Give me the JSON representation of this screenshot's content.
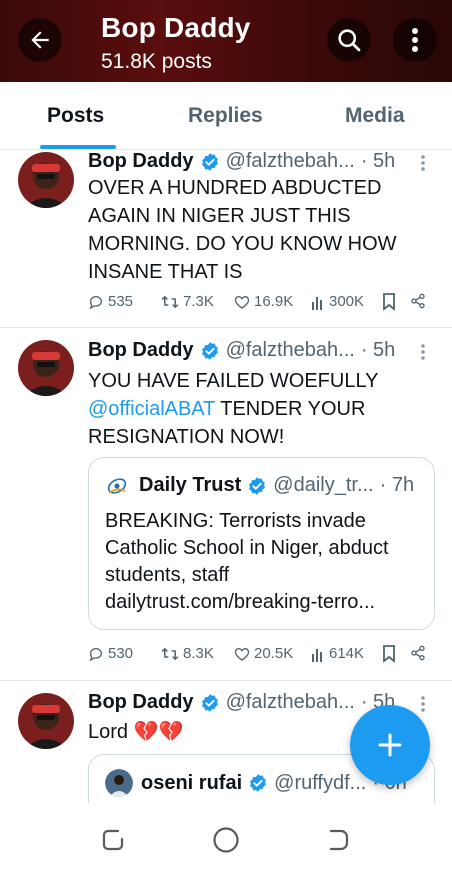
{
  "header": {
    "title": "Bop Daddy",
    "subtitle": "51.8K posts",
    "icons": [
      "back-arrow-icon",
      "search-icon",
      "more-vertical-icon"
    ]
  },
  "tabs": [
    {
      "label": "Posts",
      "active": true
    },
    {
      "label": "Replies",
      "active": false
    },
    {
      "label": "Media",
      "active": false
    }
  ],
  "posts": [
    {
      "name": "Bop Daddy",
      "handle": "@falzthebah...",
      "time": "· 5h",
      "text": "OVER A HUNDRED ABDUCTED AGAIN IN NIGER JUST THIS MORNING. DO YOU KNOW HOW INSANE THAT IS",
      "replies": "535",
      "reposts": "7.3K",
      "likes": "16.9K",
      "views": "300K"
    },
    {
      "name": "Bop Daddy",
      "handle": "@falzthebah...",
      "time": "· 5h",
      "text_before": "YOU HAVE FAILED WOEFULLY ",
      "mention": "@officialABAT",
      "text_after": " TENDER YOUR RESIGNATION NOW!",
      "quote": {
        "name": "Daily Trust",
        "handle": "@daily_tr...",
        "time": "· 7h",
        "text": "BREAKING: Terrorists invade Catholic School in Niger, abduct students, staff",
        "link": "dailytrust.com/breaking-terro..."
      },
      "replies": "530",
      "reposts": "8.3K",
      "likes": "20.5K",
      "views": "614K"
    },
    {
      "name": "Bop Daddy",
      "handle": "@falzthebah...",
      "time": "· 5h",
      "text": "Lord 💔💔",
      "quote": {
        "name": "oseni rufai",
        "handle": "@ruffydf...",
        "time": "· 6h"
      }
    }
  ],
  "colors": {
    "accent": "#1d9bf0",
    "header_bg": "#4a0b0b",
    "muted": "#536471"
  }
}
